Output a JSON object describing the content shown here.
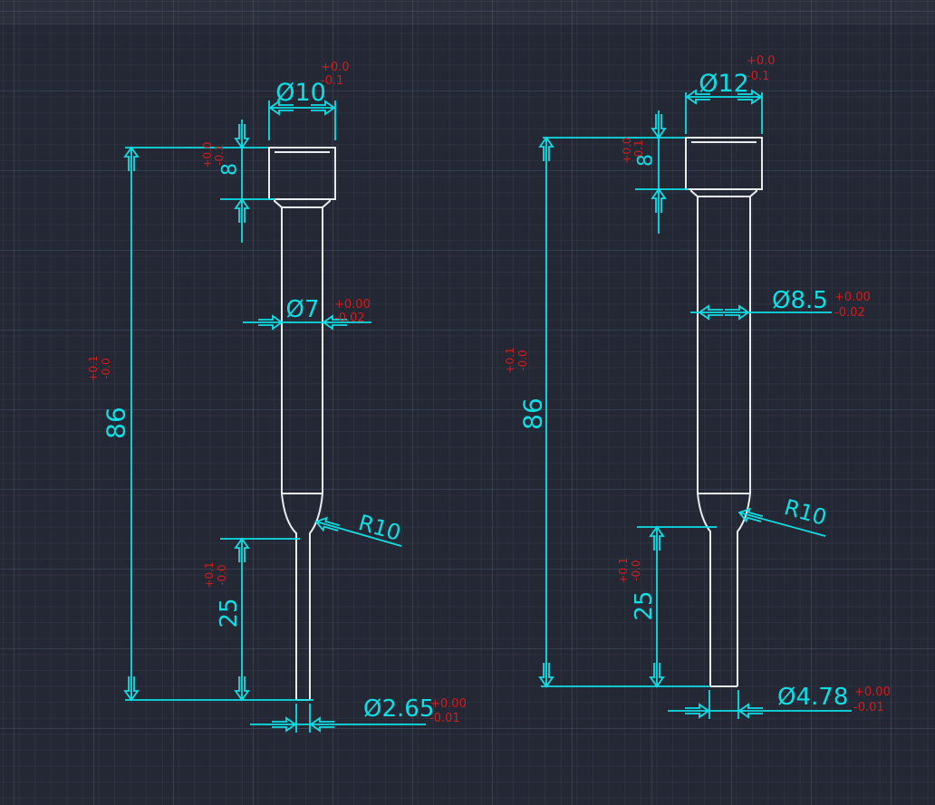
{
  "canvas": {
    "background": "#232834",
    "grid": "dark blue-gray minor/major grid"
  },
  "colors": {
    "dimension_lines": "#0edfe6",
    "tolerance_text": "#d31d1d",
    "part_geometry": "#e9ecef"
  },
  "drawing": {
    "left_punch": {
      "head_diameter": {
        "value": "Ø10",
        "tol_upper": "+0.0",
        "tol_lower": "-0.1"
      },
      "head_height": {
        "value": "8",
        "tol_upper": "+0.0",
        "tol_lower": "-0.1"
      },
      "shank_diameter": {
        "value": "Ø7",
        "tol_upper": "+0.00",
        "tol_lower": "-0.02"
      },
      "overall_length": {
        "value": "86",
        "tol_upper": "+0.1",
        "tol_lower": "-0.0"
      },
      "tip_length": {
        "value": "25",
        "tol_upper": "+0.1",
        "tol_lower": "-0.0"
      },
      "shoulder_radius": {
        "value": "R10"
      },
      "tip_diameter": {
        "value": "Ø2.65",
        "tol_upper": "+0.00",
        "tol_lower": "-0.01"
      }
    },
    "right_punch": {
      "head_diameter": {
        "value": "Ø12",
        "tol_upper": "+0.0",
        "tol_lower": "-0.1"
      },
      "head_height": {
        "value": "8",
        "tol_upper": "+0.0",
        "tol_lower": "-0.1"
      },
      "shank_diameter": {
        "value": "Ø8.5",
        "tol_upper": "+0.00",
        "tol_lower": "-0.02"
      },
      "overall_length": {
        "value": "86",
        "tol_upper": "+0.1",
        "tol_lower": "-0.0"
      },
      "tip_length": {
        "value": "25",
        "tol_upper": "+0.1",
        "tol_lower": "-0.0"
      },
      "shoulder_radius": {
        "value": "R10"
      },
      "tip_diameter": {
        "value": "Ø4.78",
        "tol_upper": "+0.00",
        "tol_lower": "-0.01"
      }
    }
  }
}
